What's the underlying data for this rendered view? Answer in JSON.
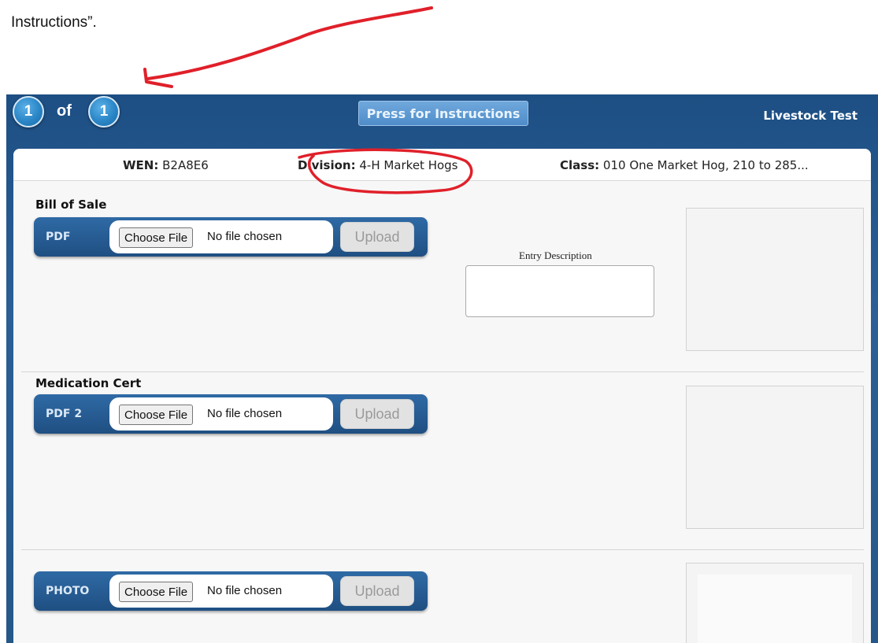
{
  "document": {
    "text": "Instructions”."
  },
  "header": {
    "current_page": "1",
    "of_label": "of",
    "total_pages": "1",
    "instructions_button": "Press for Instructions",
    "app_title": "Livestock Test"
  },
  "entry_info": {
    "wen_label": "WEN:",
    "wen_value": "B2A8E6",
    "division_label": "Division:",
    "division_value": "4-H Market Hogs",
    "class_label": "Class:",
    "class_value": "010 One Market Hog, 210 to 285..."
  },
  "entry_description": {
    "label": "Entry Description",
    "value": ""
  },
  "uploads": [
    {
      "title": "Bill of Sale",
      "type_label": "PDF",
      "choose_label": "Choose File",
      "file_status": "No file chosen",
      "upload_label": "Upload"
    },
    {
      "title": "Medication Cert",
      "type_label": "PDF 2",
      "choose_label": "Choose File",
      "file_status": "No file chosen",
      "upload_label": "Upload"
    },
    {
      "title": "",
      "type_label": "PHOTO",
      "choose_label": "Choose File",
      "file_status": "No file chosen",
      "upload_label": "Upload"
    }
  ],
  "colors": {
    "header_blue": "#2b5f95",
    "annotation_red": "#e0202a",
    "bubble_blue": "#2a86c7"
  }
}
